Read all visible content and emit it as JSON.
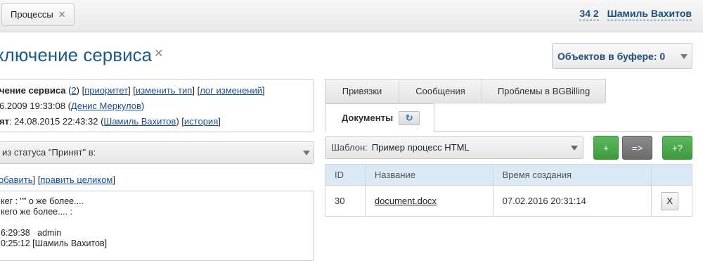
{
  "topbar": {
    "process_tab_label": "Процессы",
    "process_tab_close": "✕",
    "user_id": "34 2",
    "user_name": "Шамиль Вахитов"
  },
  "title": {
    "text": "ключение сервиса",
    "close": "✕"
  },
  "buffer": {
    "label": "Объектов в буфере: 0"
  },
  "info": {
    "line1": {
      "title": "чение сервиса",
      "open": " (",
      "count": "2",
      "close": ") ",
      "priority": "приоритет",
      "change_type": "изменить тип",
      "log": "лог изменений"
    },
    "line2": {
      "date": "6.2009 19:33:08 (",
      "user": "Денис Меркулов",
      "end": ")"
    },
    "line3": {
      "label": "ят",
      "date": ": 24.08.2015 22:43:32 (",
      "user": "Шамиль Вахитов",
      "mid": ") ",
      "history": "история"
    }
  },
  "status_select": {
    "text": " из статуса \"Принят\" в:"
  },
  "links": {
    "add": "обавить",
    "edit_whole": "править целиком"
  },
  "description": {
    "lines": [
      "кег : \"\" о же более....",
      "кего же более.... :",
      "",
      "6:29:38   admin",
      "0:25:12 [Шамиль Вахитов]"
    ]
  },
  "tabs": {
    "bindings": "Привязки",
    "messages": "Сообщения",
    "bgbilling": "Проблемы в BGBilling",
    "documents": "Документы"
  },
  "template": {
    "label": "Шаблон:",
    "value": "Пример процесс HTML"
  },
  "buttons": {
    "add": "+",
    "move": "=>",
    "add_help": "+?"
  },
  "table": {
    "headers": [
      "ID",
      "Название",
      "Время создания",
      ""
    ],
    "rows": [
      {
        "id": "30",
        "name": "document.docx",
        "created": "07.02.2016 20:31:14",
        "action": "X"
      }
    ]
  },
  "colors": {
    "accent": "#1d5a8c",
    "green": "#4cae4c",
    "gray": "#7a7a7a",
    "table_header": "#dbe9f5"
  }
}
